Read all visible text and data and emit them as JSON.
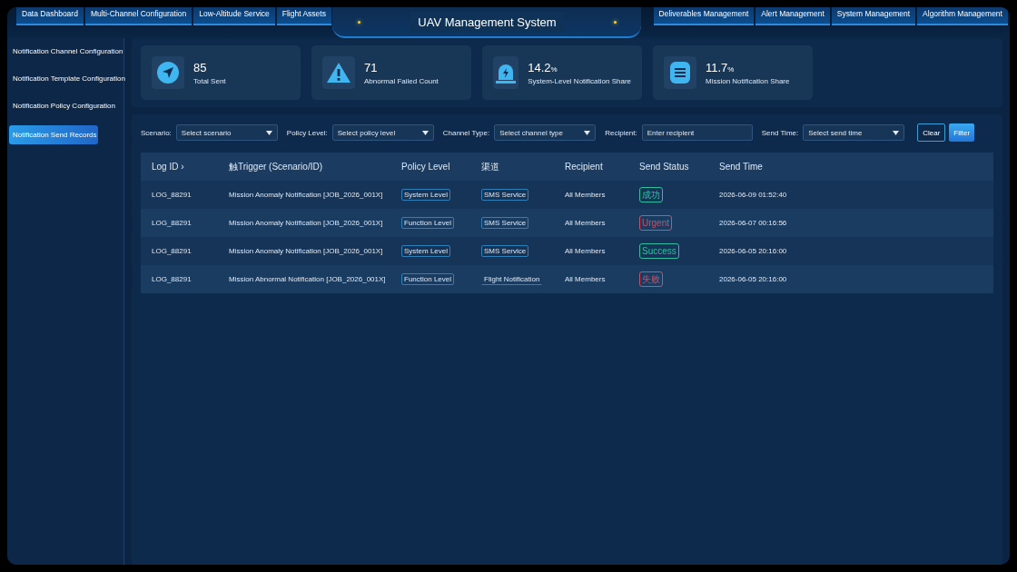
{
  "window": {
    "title": "UAV Management System"
  },
  "nav_left": [
    {
      "label": "Data Dashboard"
    },
    {
      "label": "Multi-Channel Configuration"
    },
    {
      "label": "Low-Altitude Service"
    },
    {
      "label": "Flight Assets"
    }
  ],
  "nav_right": [
    {
      "label": "Deliverables Management"
    },
    {
      "label": "Alert Management"
    },
    {
      "label": "System Management"
    },
    {
      "label": "Algorithm Management"
    }
  ],
  "sidebar": {
    "items": [
      {
        "label": "Notification Channel Configuration",
        "selected": false
      },
      {
        "label": "Notification Template Configuration",
        "selected": false
      },
      {
        "label": "Notification Policy Configuration",
        "selected": false
      },
      {
        "label": "Notification Send Records",
        "selected": true
      }
    ]
  },
  "stats": [
    {
      "kind": "send",
      "value": "85",
      "label": "Total Sent"
    },
    {
      "kind": "warning",
      "value": "71",
      "label": "Abnormal Failed Count"
    },
    {
      "kind": "alarm",
      "value": "14.2",
      "unit": "%",
      "label": "System-Level Notification Share"
    },
    {
      "kind": "list",
      "value": "11.7",
      "unit": "%",
      "label": "Mission Notification Share"
    }
  ],
  "filters": [
    {
      "kind": "select",
      "label": "Scenario:",
      "placeholder": "Select scenario"
    },
    {
      "kind": "select",
      "label": "Policy Level:",
      "placeholder": "Select policy level"
    },
    {
      "kind": "select",
      "label": "Channel Type:",
      "placeholder": "Select channel type"
    },
    {
      "kind": "input",
      "label": "Recipient:",
      "placeholder": "Enter recipient"
    },
    {
      "kind": "select",
      "label": "Send Time:",
      "placeholder": "Select send time"
    }
  ],
  "buttons": [
    {
      "kind": "outline",
      "label": "Clear"
    },
    {
      "kind": "primary",
      "label": "Filter"
    }
  ],
  "table": {
    "columns": [
      "Log ID ›",
      "触Trigger (Scenario/ID)",
      "Policy Level",
      "渠道",
      "Recipient",
      "Send Status",
      "Send Time"
    ],
    "rows": [
      {
        "log_id": "LOG_88291",
        "trigger": "Mission Anomaly Notification [JOB_2026_001X]",
        "policy": "System Level",
        "channel": "SMS Service",
        "channel_boxed": true,
        "recipient": "All Members",
        "status": "成功",
        "color": "#2fbfa0",
        "time": "2026-06-09 01:52:40"
      },
      {
        "log_id": "LOG_88291",
        "trigger": "Mission Anomaly Notification [JOB_2026_001X]",
        "policy": "Function Level",
        "channel": "SMS Service",
        "channel_boxed": true,
        "recipient": "All Members",
        "status": "Urgent",
        "color": "#c8506a",
        "time": "2026-06-07 00:16:56"
      },
      {
        "log_id": "LOG_88291",
        "trigger": "Mission Anomaly Notification [JOB_2026_001X]",
        "policy": "System Level",
        "channel": "SMS Service",
        "channel_boxed": true,
        "recipient": "All Members",
        "status": "Success",
        "color": "#2fbfa0",
        "time": "2026-06-05 20:16:00"
      },
      {
        "log_id": "LOG_88291",
        "trigger": "Mission Abnormal Notification [JOB_2026_001X]",
        "policy": "Function Level",
        "channel": "Flight Notification",
        "channel_boxed": false,
        "recipient": "All Members",
        "status": "失败",
        "color": "#c8506a",
        "time": "2026-06-05 20:16:00"
      }
    ]
  }
}
